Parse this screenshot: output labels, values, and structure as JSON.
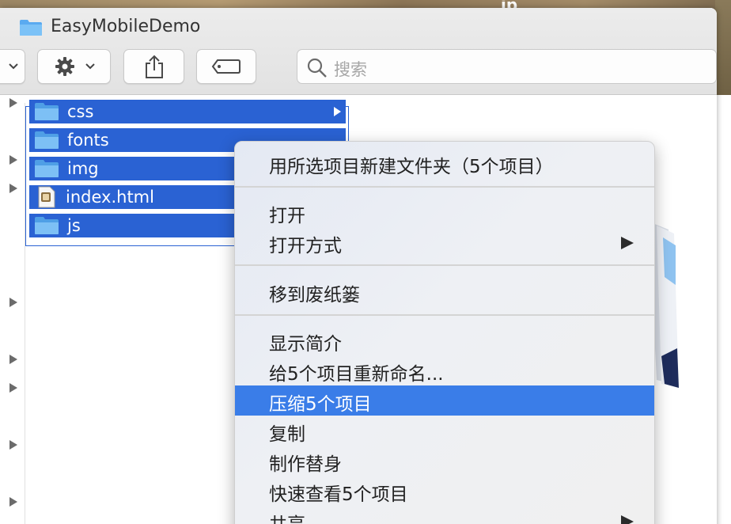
{
  "window": {
    "title": "EasyMobileDemo",
    "wallpaper_text": "ip"
  },
  "toolbar": {
    "search_placeholder": "搜索",
    "buttons": [
      "view-options",
      "action-gear",
      "share",
      "tags"
    ]
  },
  "files": [
    {
      "name": "css",
      "type": "folder",
      "selected": true,
      "expandable": true
    },
    {
      "name": "fonts",
      "type": "folder",
      "selected": true,
      "expandable": true
    },
    {
      "name": "img",
      "type": "folder",
      "selected": true,
      "expandable": true
    },
    {
      "name": "index.html",
      "type": "html-file",
      "selected": true,
      "expandable": false
    },
    {
      "name": "js",
      "type": "folder",
      "selected": true,
      "expandable": true
    }
  ],
  "context_menu": {
    "items": [
      {
        "label": "用所选项目新建文件夹（5个项目）"
      },
      {
        "label": "打开"
      },
      {
        "label": "打开方式",
        "submenu": true
      },
      {
        "label": "移到废纸篓"
      },
      {
        "label": "显示简介"
      },
      {
        "label": "给5个项目重新命名..."
      },
      {
        "label": "压缩5个项目",
        "highlighted": true
      },
      {
        "label": "复制"
      },
      {
        "label": "制作替身"
      },
      {
        "label": "快速查看5个项目"
      },
      {
        "label": "共享",
        "submenu": true
      }
    ]
  },
  "colors": {
    "selection": "#2a62d3",
    "menu_highlight": "#3a7de8",
    "folder": "#6fb6ee"
  }
}
